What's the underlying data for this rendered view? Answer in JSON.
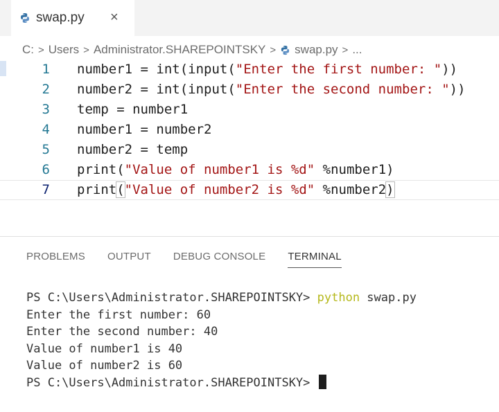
{
  "tab": {
    "filename": "swap.py",
    "close": "×",
    "icon": "python-icon"
  },
  "breadcrumb": [
    "C:",
    "Users",
    "Administrator.SHAREPOINTSKY",
    "swap.py",
    "..."
  ],
  "breadcrumb_separator": ">",
  "code": [
    {
      "n": "1",
      "parts": [
        {
          "t": "number1 = int(input("
        },
        {
          "t": "\"Enter the first number: \"",
          "s": "str"
        },
        {
          "t": "))"
        }
      ]
    },
    {
      "n": "2",
      "parts": [
        {
          "t": "number2 = int(input("
        },
        {
          "t": "\"Enter the second number: \"",
          "s": "str"
        },
        {
          "t": "))"
        }
      ]
    },
    {
      "n": "3",
      "parts": [
        {
          "t": "temp = number1"
        }
      ]
    },
    {
      "n": "4",
      "parts": [
        {
          "t": "number1 = number2"
        }
      ]
    },
    {
      "n": "5",
      "parts": [
        {
          "t": "number2 = temp"
        }
      ]
    },
    {
      "n": "6",
      "parts": [
        {
          "t": "print("
        },
        {
          "t": "\"Value of number1 is %d\"",
          "s": "str"
        },
        {
          "t": " %number1)"
        }
      ]
    },
    {
      "n": "7",
      "current": true,
      "parts": [
        {
          "t": "print"
        },
        {
          "t": "(",
          "s": "bracket"
        },
        {
          "t": "\"Value of number2 is %d\"",
          "s": "str"
        },
        {
          "t": " %number2"
        },
        {
          "t": ")",
          "s": "bracket"
        }
      ]
    }
  ],
  "panel_tabs": [
    {
      "label": "PROBLEMS",
      "active": false
    },
    {
      "label": "OUTPUT",
      "active": false
    },
    {
      "label": "DEBUG CONSOLE",
      "active": false
    },
    {
      "label": "TERMINAL",
      "active": true
    }
  ],
  "terminal": {
    "prompt_line": {
      "prompt": "PS C:\\Users\\Administrator.SHAREPOINTSKY> ",
      "command": "python",
      "args": " swap.py"
    },
    "output": [
      "Enter the first number: 60",
      "Enter the second number: 40",
      "Value of number1 is 40",
      "Value of number2 is 60"
    ],
    "final_prompt": "PS C:\\Users\\Administrator.SHAREPOINTSKY> "
  },
  "colors": {
    "string": "#a31515",
    "line_number": "#237893",
    "python_cmd": "#b5b81a",
    "python_icon": "#3572a5"
  }
}
